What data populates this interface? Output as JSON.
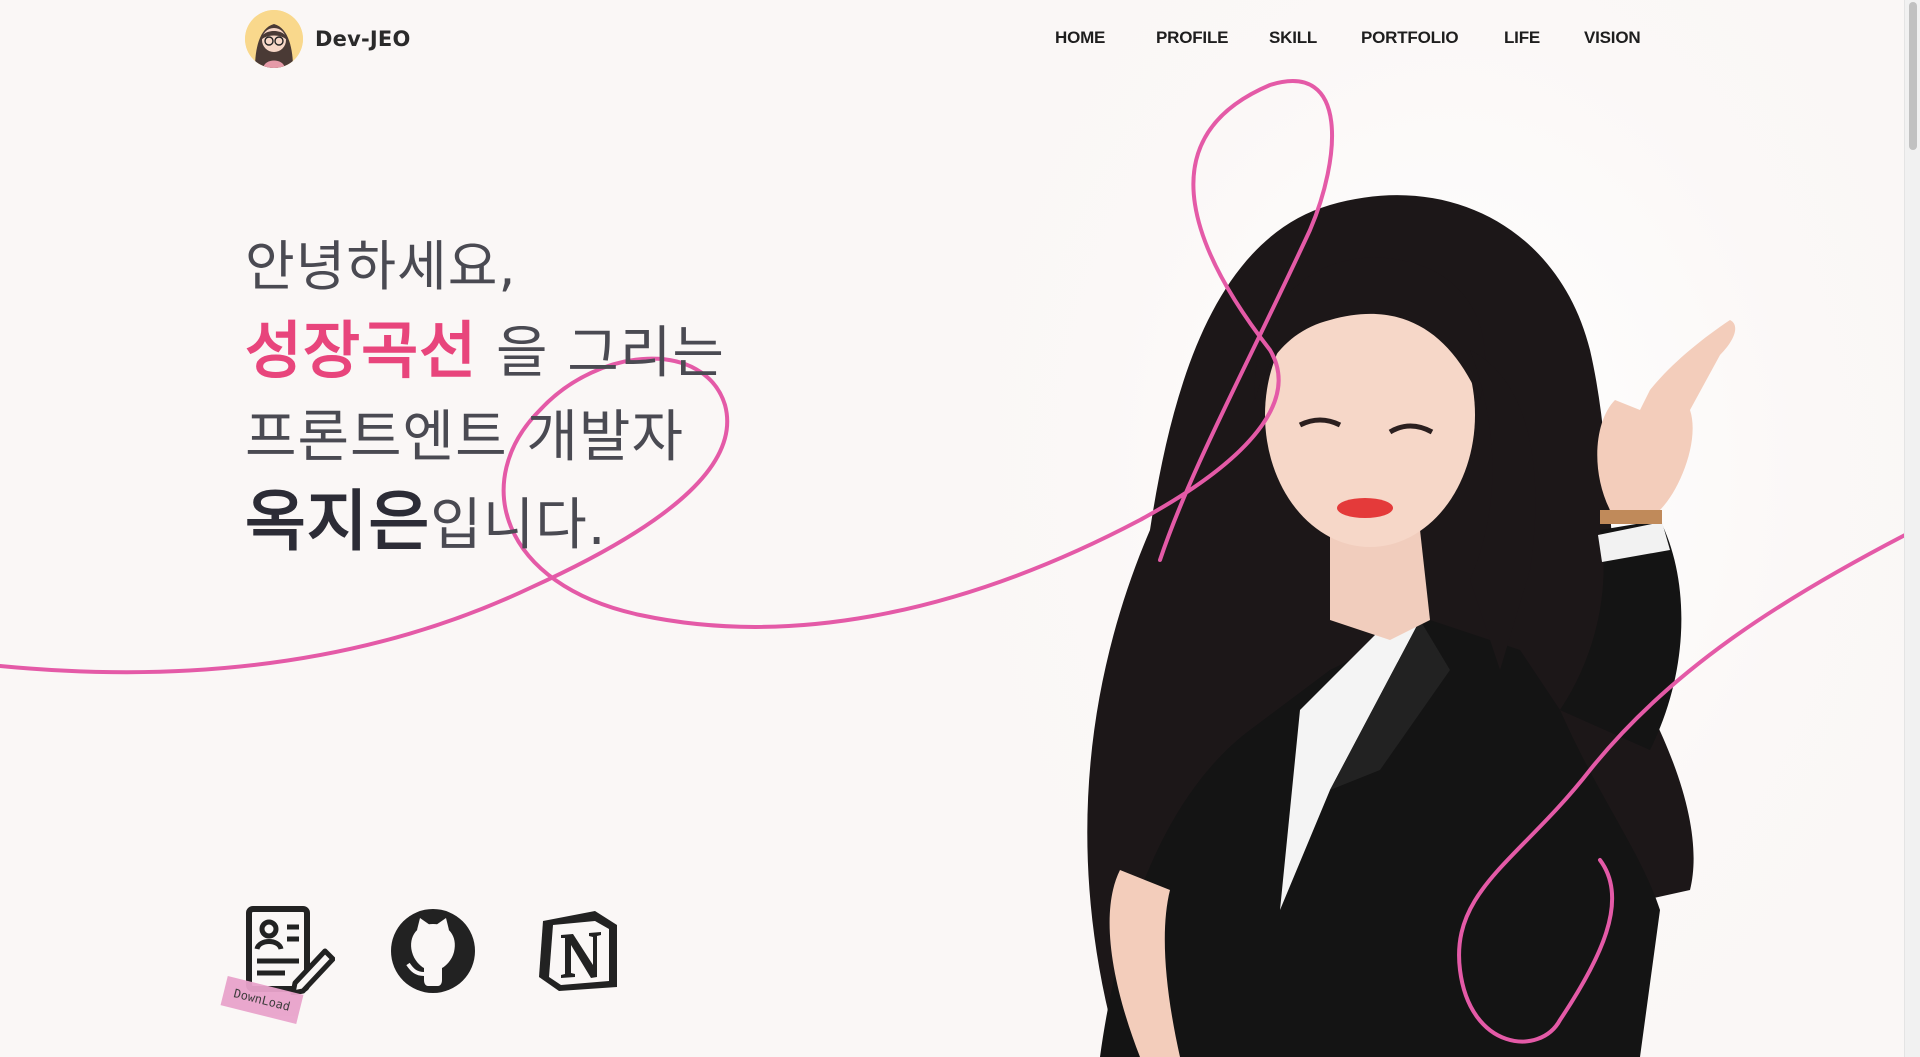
{
  "brand": {
    "name": "Dev-JEO",
    "avatar_icon": "avatar-illustration"
  },
  "nav": {
    "items": [
      {
        "label": "HOME"
      },
      {
        "label": "PROFILE"
      },
      {
        "label": "SKILL"
      },
      {
        "label": "PORTFOLIO"
      },
      {
        "label": "LIFE"
      },
      {
        "label": "VISION"
      }
    ]
  },
  "hero": {
    "greeting": "안녕하세요,",
    "highlight": "성장곡선",
    "line2_rest": " 을 그리는",
    "line3": "프론트엔트 개발자",
    "name": "옥지은",
    "line4_rest": "입니다."
  },
  "links": {
    "resume_icon": "resume-icon",
    "download_label": "DownLoad",
    "github_icon": "github-icon",
    "notion_icon": "notion-icon"
  },
  "colors": {
    "accent": "#e8457c",
    "curve": "#e35ca6",
    "background": "#faf7f6",
    "text": "#4a4a52"
  }
}
